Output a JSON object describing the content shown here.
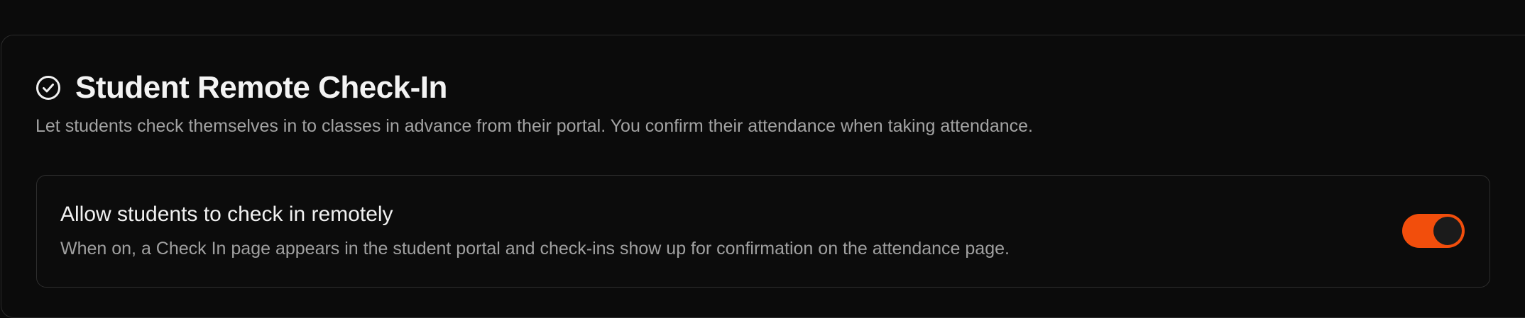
{
  "section": {
    "icon": "check-circle-icon",
    "title": "Student Remote Check-In",
    "description": "Let students check themselves in to classes in advance from their portal. You confirm their attendance when taking attendance."
  },
  "setting": {
    "label": "Allow students to check in remotely",
    "help": "When on, a Check In page appears in the student portal and check-ins show up for confirmation on the attendance page.",
    "toggle": {
      "enabled": true,
      "accent_color": "#f24e0c"
    }
  }
}
